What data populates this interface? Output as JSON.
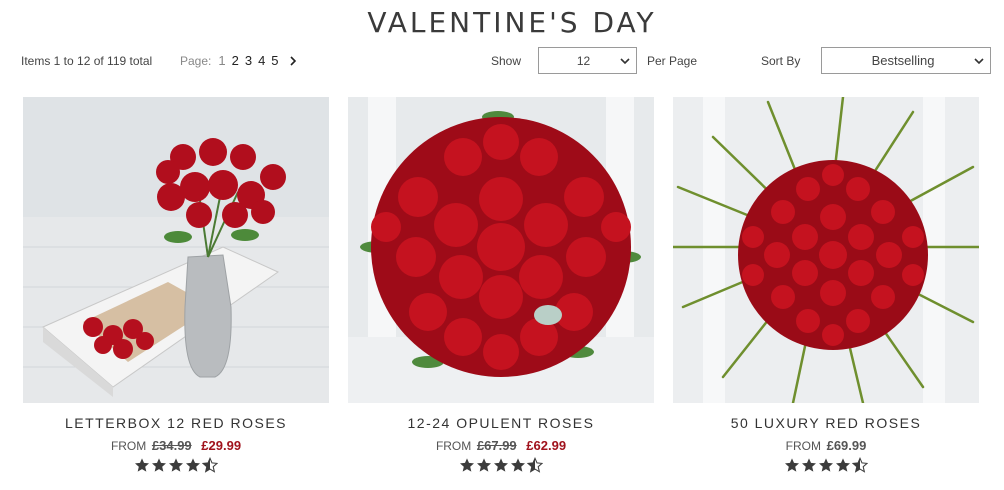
{
  "page": {
    "title": "VALENTINE'S DAY"
  },
  "toolbar": {
    "items_count": "Items 1 to 12 of 119 total",
    "pager_label": "Page:",
    "pages": [
      "1",
      "2",
      "3",
      "4",
      "5"
    ],
    "current_page": "1",
    "show_label": "Show",
    "show_value": "12",
    "per_page_label": "Per Page",
    "sort_label": "Sort By",
    "sort_value": "Bestselling"
  },
  "products": [
    {
      "name": "LETTERBOX 12 RED ROSES",
      "from": "FROM",
      "was": "£34.99",
      "now": "£29.99",
      "rating": 4.5
    },
    {
      "name": "12-24 OPULENT ROSES",
      "from": "FROM",
      "was": "£67.99",
      "now": "£62.99",
      "rating": 4.5
    },
    {
      "name": "50 LUXURY RED ROSES",
      "from": "FROM",
      "price": "£69.99",
      "rating": 4.5
    }
  ],
  "colors": {
    "sale_price": "#a0121c",
    "star": "#3c3c3c",
    "rose": "#c0101e"
  },
  "icons": {
    "next": "chevron-right-icon",
    "dropdown": "chevron-down-icon",
    "star": "star-icon"
  }
}
